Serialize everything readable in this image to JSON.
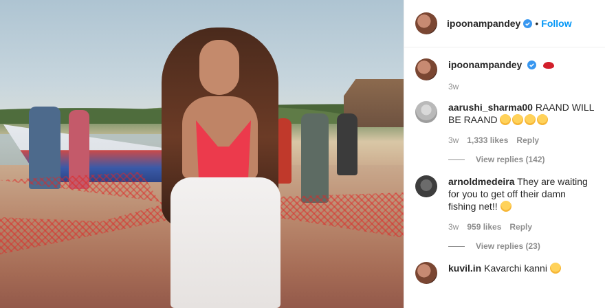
{
  "post": {
    "author": "ipoonampandey",
    "follow_label": "Follow",
    "caption_time": "3w"
  },
  "comments": [
    {
      "user": "aarushi_sharma00",
      "text": "RAAND WILL BE RAAND",
      "emoji_count": 4,
      "time": "3w",
      "likes": "1,333 likes",
      "reply_label": "Reply",
      "view_replies": "View replies (142)"
    },
    {
      "user": "arnoldmedeira",
      "text": "They are waiting for you to get off their damn fishing net!!",
      "emoji_count": 1,
      "time": "3w",
      "likes": "959 likes",
      "reply_label": "Reply",
      "view_replies": "View replies (23)"
    },
    {
      "user": "kuvil.in",
      "text": "Kavarchi kanni",
      "emoji_count": 1
    }
  ],
  "icons": {
    "verified": "verified-badge-icon",
    "lips": "lips-emoji-icon",
    "laugh": "laughing-emoji-icon"
  },
  "colors": {
    "accent": "#0095f6",
    "muted": "#8e8e8e"
  }
}
